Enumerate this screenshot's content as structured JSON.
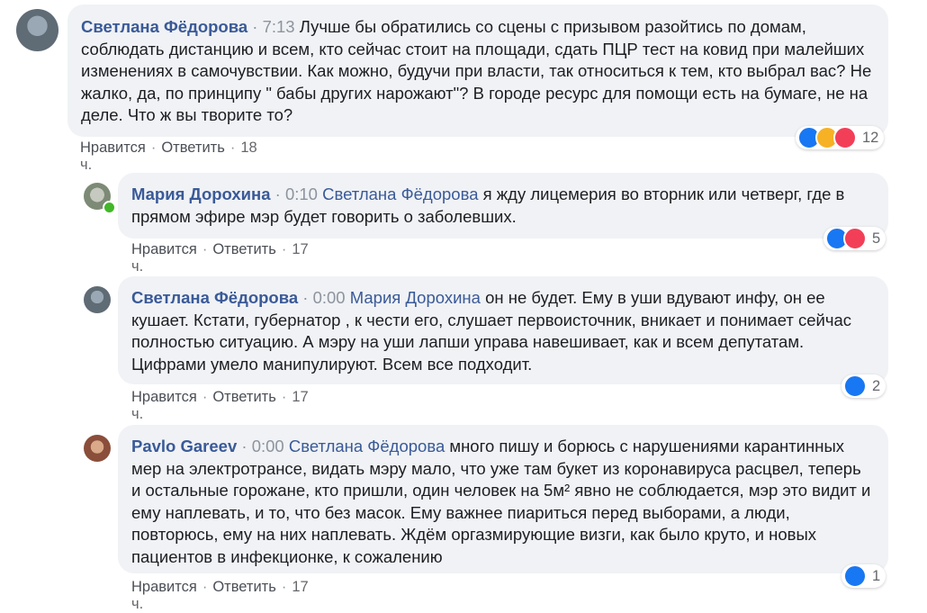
{
  "comments": [
    {
      "author": "Светлана Фёдорова",
      "time": "7:13",
      "mention": "",
      "text": "Лучше бы обратились со сцены с призывом разойтись по домам, соблюдать дистанцию и всем, кто сейчас стоит на площади, сдать ПЦР тест на ковид при малейших изменениях в самочувствии. Как можно, будучи при власти, так относиться к тем, кто выбрал вас? Не жалко, да, по принципу \" бабы других нарожают\"? В городе ресурс для помощи есть на бумаге, не на деле. Что ж вы творите то?",
      "like_label": "Нравится",
      "reply_label": "Ответить",
      "age": "18 ч.",
      "reaction_count": "12",
      "reactions": [
        "like-icon",
        "sad-icon",
        "love-icon"
      ]
    },
    {
      "author": "Мария Дорохина",
      "time": "0:10",
      "mention": "Светлана Фёдорова",
      "text": "я жду лицемерия во вторник или четверг, где в прямом эфире мэр будет говорить о заболевших.",
      "like_label": "Нравится",
      "reply_label": "Ответить",
      "age": "17 ч.",
      "reaction_count": "5",
      "reactions": [
        "like-icon",
        "love-icon"
      ]
    },
    {
      "author": "Светлана Фёдорова",
      "time": "0:00",
      "mention": "Мария Дорохина",
      "text": "он не будет. Ему в уши вдувают инфу, он ее кушает. Кстати, губернатор , к чести его, слушает первоисточник, вникает и понимает сейчас полностью ситуацию. А мэру на уши лапши управа навешивает, как и всем депутатам. Цифрами умело манипулируют. Всем все подходит.",
      "like_label": "Нравится",
      "reply_label": "Ответить",
      "age": "17 ч.",
      "reaction_count": "2",
      "reactions": [
        "like-icon"
      ]
    },
    {
      "author": "Pavlo Gareev",
      "time": "0:00",
      "mention": "Светлана Фёдорова",
      "text": "много пишу и борюсь с нарушениями карантинных мер на электротрансе, видать мэру мало, что уже там букет из коронавируса расцвел, теперь и остальные горожане, кто пришли, один человек на 5м² явно не соблюдается, мэр это видит и ему наплевать, и то, что без масок. Ему важнее пиариться перед выборами, а люди, повторюсь, ему на них наплевать. Ждём оргазмирующие визги, как было круто, и новых пациентов в инфекционке, к сожалению",
      "like_label": "Нравится",
      "reply_label": "Ответить",
      "age": "17 ч.",
      "reaction_count": "1",
      "reactions": [
        "like-icon"
      ]
    }
  ],
  "separator": "·",
  "colors": {
    "link": "#3a5a98",
    "bubble": "#f0f2f5",
    "like": "#1877f2",
    "love": "#f33e58",
    "sad": "#f7b125"
  }
}
